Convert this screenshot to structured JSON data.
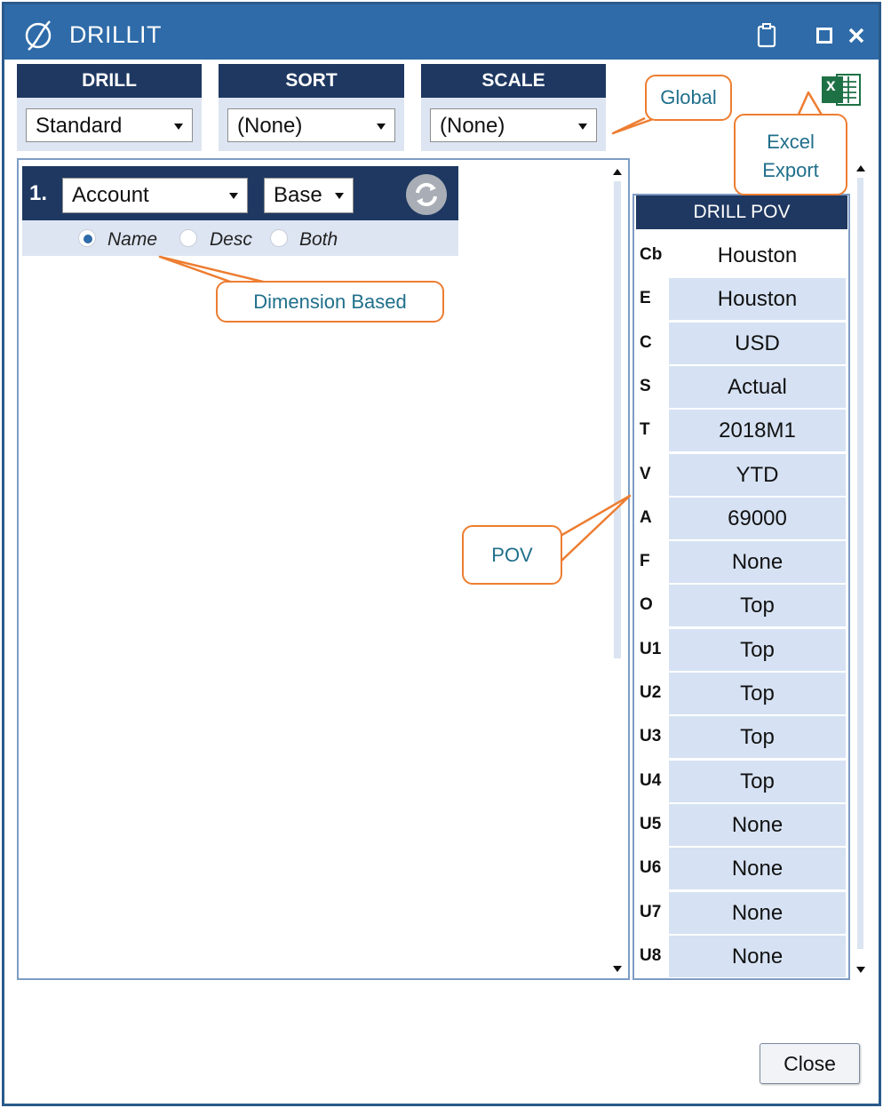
{
  "window": {
    "title": "DRILLIT",
    "maximize_icon": "maximize-icon",
    "close_icon": "close-icon",
    "clipboard_icon": "clipboard-icon"
  },
  "toolbar": {
    "drill": {
      "header": "DRILL",
      "value": "Standard"
    },
    "sort": {
      "header": "SORT",
      "value": "(None)"
    },
    "scale": {
      "header": "SCALE",
      "value": "(None)"
    }
  },
  "dimension_row": {
    "index": "1.",
    "dimension": "Account",
    "level": "Base",
    "refresh_icon": "refresh-icon",
    "radio": [
      {
        "label": "Name",
        "selected": true
      },
      {
        "label": "Desc",
        "selected": false
      },
      {
        "label": "Both",
        "selected": false
      }
    ]
  },
  "pov": {
    "header": "DRILL POV",
    "rows": [
      {
        "key": "Cb",
        "value": "Houston"
      },
      {
        "key": "E",
        "value": "Houston"
      },
      {
        "key": "C",
        "value": "USD"
      },
      {
        "key": "S",
        "value": "Actual"
      },
      {
        "key": "T",
        "value": "2018M1"
      },
      {
        "key": "V",
        "value": "YTD"
      },
      {
        "key": "A",
        "value": "69000"
      },
      {
        "key": "F",
        "value": "None"
      },
      {
        "key": "O",
        "value": "Top"
      },
      {
        "key": "U1",
        "value": "Top"
      },
      {
        "key": "U2",
        "value": "Top"
      },
      {
        "key": "U3",
        "value": "Top"
      },
      {
        "key": "U4",
        "value": "Top"
      },
      {
        "key": "U5",
        "value": "None"
      },
      {
        "key": "U6",
        "value": "None"
      },
      {
        "key": "U7",
        "value": "None"
      },
      {
        "key": "U8",
        "value": "None"
      }
    ]
  },
  "callouts": {
    "global": "Global",
    "excel_line1": "Excel",
    "excel_line2": "Export",
    "dimension": "Dimension Based",
    "pov": "POV"
  },
  "excel_icon_letter": "x",
  "buttons": {
    "close": "Close"
  },
  "colors": {
    "titlebar": "#2e6ba8",
    "header": "#1e3861",
    "control_bg": "#dde5f2",
    "pov_cell": "#d6e2f3",
    "callout_border": "#ed7d31",
    "callout_text": "#1f6f8b"
  }
}
